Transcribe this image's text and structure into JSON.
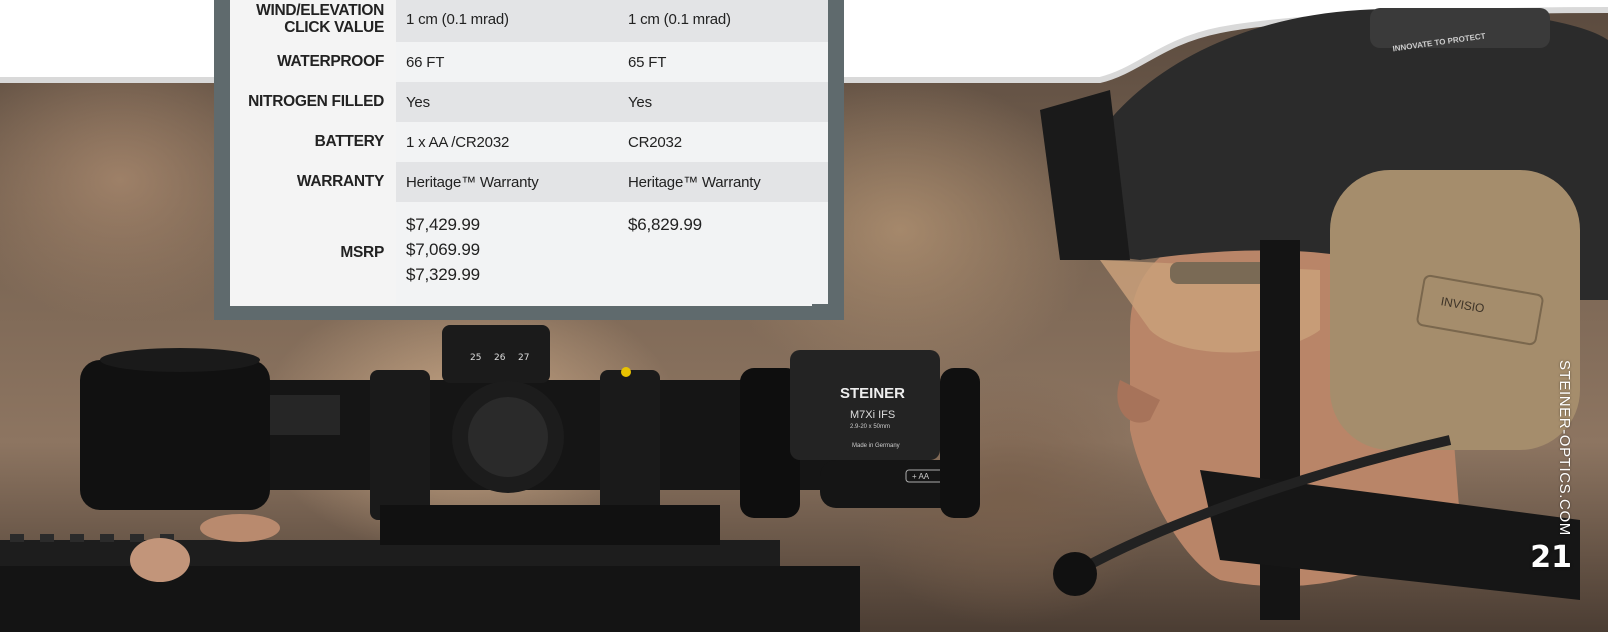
{
  "spec_table": {
    "rows": [
      {
        "label": "WIND/ELEVATION CLICK VALUE",
        "col1": "1 cm (0.1 mrad)",
        "col2": "1 cm (0.1 mrad)"
      },
      {
        "label": "WATERPROOF",
        "col1": "66 FT",
        "col2": "65 FT"
      },
      {
        "label": "NITROGEN FILLED",
        "col1": "Yes",
        "col2": "Yes"
      },
      {
        "label": "BATTERY",
        "col1": "1 x AA /CR2032",
        "col2": "CR2032"
      },
      {
        "label": "WARRANTY",
        "col1": "Heritage™ Warranty",
        "col2": "Heritage™ Warranty"
      }
    ],
    "msrp": {
      "label": "MSRP",
      "col1": [
        "$7,429.99",
        "$7,069.99",
        "$7,329.99"
      ],
      "col2": "$6,829.99"
    }
  },
  "photo": {
    "scope_brand": "STEINER",
    "scope_model": "M7Xi IFS",
    "scope_spec": "2.9-20 x 50mm",
    "scope_origin": "Made in Germany",
    "battery_marking": "+ AA",
    "helmet_text": "INNOVATE TO PROTECT",
    "headset_brand": "INVISIO"
  },
  "footer": {
    "site_url": "STEINER-OPTICS.COM",
    "page_number": "21"
  },
  "colors": {
    "panel_frame": "#5f6a6d",
    "row_shade": "#e3e4e6",
    "row_light": "#f2f3f4"
  }
}
